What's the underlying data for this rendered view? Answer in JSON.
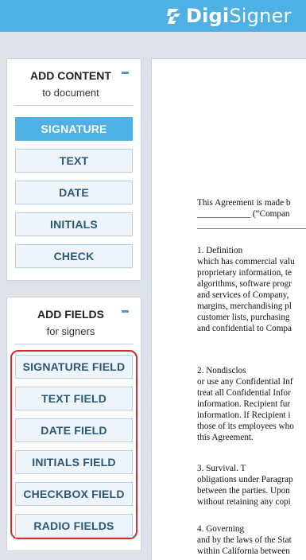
{
  "header": {
    "brand_bold": "Digi",
    "brand_light": "Signer",
    "logo_icon": "digisigner-pen-icon"
  },
  "content_panel": {
    "title": "ADD CONTENT",
    "subtitle": "to document",
    "collapse_icon": "minus-icon",
    "buttons": [
      "SIGNATURE",
      "TEXT",
      "DATE",
      "INITIALS",
      "CHECK"
    ],
    "active_button": "SIGNATURE"
  },
  "fields_panel": {
    "title": "ADD FIELDS",
    "subtitle": "for signers",
    "collapse_icon": "minus-icon",
    "buttons": [
      "SIGNATURE FIELD",
      "TEXT FIELD",
      "DATE FIELD",
      "INITIALS FIELD",
      "CHECKBOX FIELD",
      "RADIO FIELDS"
    ]
  },
  "document": {
    "lines": [
      "This Agreement is made b",
      "____________ (“Compan",
      "____________________________",
      "1.                 Definition",
      "which has commercial valu",
      "proprietary information, te",
      "algorithms, software progr",
      "and services of Company,",
      "margins, merchandising pl",
      "customer lists, purchasing",
      "and confidential to Compa",
      "2.                 Nondisclos",
      "or use any Confidential Inf",
      "treat all Confidential Infor",
      "information.  Recipient fur",
      "information.  If Recipient i",
      "those of its employees who",
      "this Agreement.",
      "3.                 Survival.  T",
      "obligations under Paragrap",
      "between the parties.  Upon",
      "without retaining any copi",
      "4.                 Governing",
      "and by the laws of the Stat",
      "within California between"
    ]
  },
  "colors": {
    "accent": "#4fb0e6",
    "button_text": "#2b5876",
    "highlight": "#d92b2b"
  }
}
